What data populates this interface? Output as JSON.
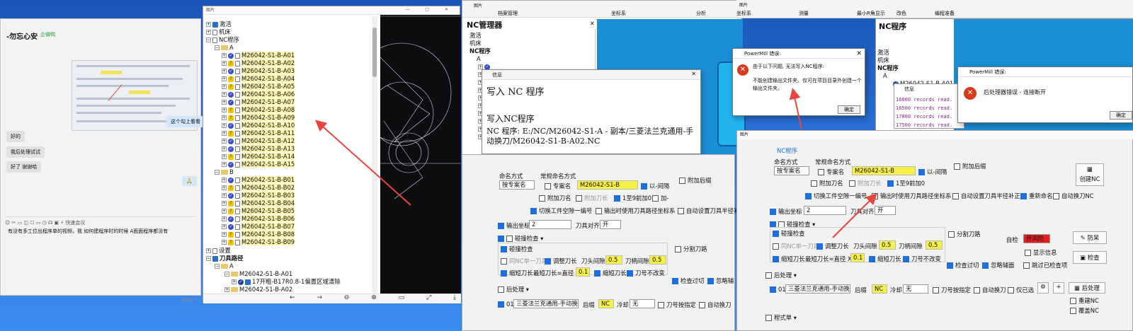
{
  "chat": {
    "contact": "-勿忘心安",
    "contact_tag": "企微鸭",
    "msg_check": "这个勾上看看",
    "msg_ok": "好的",
    "msg_try": "我后处理试试",
    "msg_thanks": "好了 谢谢哈",
    "msg_emoji": "🙏",
    "tools": "☺  ✂  ▭  ◫  ☐  ▭  ◷  ☊  ▣   ⚡ 快速会议",
    "input_text": "有没有多工位出程序单的视频，我 如何建程序时的时候 A面面程序都没有",
    "send_label": "发送(S)"
  },
  "tree": {
    "title": "图片",
    "nodes": {
      "activate": "激活",
      "machine": "机床",
      "ncprog": "NC程序",
      "groupA": "A",
      "groupB": "B",
      "settings": "设置",
      "toolpath": "刀具路径",
      "tpA": "A",
      "tp1": "M26042-S1-B-A01",
      "tp1sub": "17开粗-B17R0.8-1偏置区域清除",
      "tp2": "M26042-S1-B-A02"
    },
    "a_items": [
      "M26042-S1-B-A01",
      "M26042-S1-B-A02",
      "M26042-S1-B-A03",
      "M26042-S1-B-A04",
      "M26042-S1-B-A05",
      "M26042-S1-B-A06",
      "M26042-S1-B-A07",
      "M26042-S1-B-A08",
      "M26042-S1-B-A09",
      "M26042-S1-B-A10",
      "M26042-S1-B-A11",
      "M26042-S1-B-A12",
      "M26042-S1-B-A13",
      "M26042-S1-B-A14",
      "M26042-S1-B-A15"
    ],
    "b_items": [
      "M26042-S1-B-B01",
      "M26042-S1-B-B02",
      "M26042-S1-B-B03",
      "M26042-S1-B-B04",
      "M26042-S1-B-B05",
      "M26042-S1-B-B06",
      "M26042-S1-B-B07",
      "M26042-S1-B-B08",
      "M26042-S1-B-B09"
    ],
    "toolbar": "←  →  ⊖  ⊕  ▭  ⤢  ⤓  ⤡"
  },
  "mid": {
    "title_bar": "图片",
    "menu": [
      "档案管理",
      "坐标系",
      "分析",
      "测量",
      "最小R角显示",
      "改色",
      "编程准备"
    ],
    "manager_title": "NC管理器",
    "left_nodes": [
      "激活",
      "机床",
      "NC程序",
      "A"
    ],
    "info_title": "信息",
    "info_big": "写入 NC 程序",
    "info_line2": "写入NC程序",
    "info_line3": "NC 程序:  E:/NC/M26042-S1-A - 副本/三菱法兰克通用-手动换刀/M26042-S1-B-A02.NC",
    "err_title": "PowerMill 错误:",
    "err_msg1": "由于以下问题, 无法写入NC程序:",
    "err_msg2": "不能创建输出文件夹。仅可在项目目录外创建一个输出文件夹。",
    "err_btn": "确定"
  },
  "optL": {
    "nc_label": "NC程序",
    "naming": "命名方式",
    "naming_sel": "按专案名",
    "regular_naming": "常规命名方式",
    "proj_name": "专案名",
    "proj_value": "M26042-S1-B",
    "interval": "以-间隔",
    "append_post": "附加后缀",
    "append_tool": "附加刀名",
    "append_len": "附加刀长",
    "pad9": "1至9前加0",
    "add": "加-",
    "switch_ws": "切换工件空隙一编号",
    "output_coord": "输出时使用刀具路径坐标系",
    "auto_radius": "自动设置刀具半径补",
    "out_coord": "输出坐标",
    "out_coord_val": "2",
    "tool_align": "刀具对齐",
    "tool_align_val": "开",
    "collision": "碰撞检查",
    "collision_chk": "碰撞检查",
    "same_nc": "同NC单一刀具",
    "adjust_len": "调整刀长",
    "head_gap": "刀头间隙",
    "head_gap_val": "0.5",
    "shank_gap": "刀柄间隙",
    "shank_gap_val": "0.5",
    "shorten": "缩短刀长",
    "min_len": "最短刀长=直径 X",
    "min_len_val": "0.1",
    "shorten2": "缩短刀长",
    "tool_no_change": "刀号不改变",
    "split": "分割刀路",
    "check_over": "检查过切",
    "ignore": "忽略辅",
    "post": "后处理",
    "post01": "01",
    "post_sel": "三菱法兰克通用-手动换",
    "suffix": "后缀",
    "suffix_val": "NC",
    "coolant": "冷却",
    "coolant_val": "无",
    "tool_change_cfg": "刀号按指定",
    "auto_change": "自动换刀"
  },
  "right": {
    "title_bar": "图片",
    "menu": [
      "坐标系",
      "分析",
      "测量",
      "最小R角显示",
      "改色",
      "编程准备"
    ],
    "tree_title": "NC程序",
    "left_nodes": [
      "激活",
      "机床",
      "NC程序",
      "A",
      "M26042-S1-B-A01"
    ],
    "info_title": "信息",
    "records": [
      "16000 records read.",
      "16500 records read.",
      "17000 records read.",
      "17500 records read."
    ],
    "err_title": "PowerMill 错误:",
    "err_msg": "后处理器错误 - 连接断开",
    "err_btn": "确定"
  },
  "optR": {
    "nc_label": "NC程序",
    "naming": "命名方式",
    "naming_sel": "按专案名",
    "regular_naming": "常规命名方式",
    "proj_name": "专案名",
    "proj_value": "M26042-S1-B",
    "interval": "以-间隔",
    "append_post": "附加后缀",
    "append_tool": "附加刀名",
    "append_len": "附加刀长",
    "pad9": "1至9前加0",
    "create_nc": "创建NC",
    "switch_ws": "切换工件空隙一编号",
    "output_coord": "输出时使用刀具路径坐标系",
    "auto_radius": "自动设置刀具半径补正",
    "rename": "重新命名",
    "auto_tc": "自动换刀NC",
    "out_coord": "输出坐标",
    "out_coord_val": "2",
    "tool_align": "刀具对齐",
    "tool_align_val": "开",
    "collision": "碰撞检查",
    "collision_chk": "碰撞检查",
    "same_nc": "同NC单一刀具",
    "adjust_len": "调整刀长",
    "head_gap": "刀头间隙",
    "head_gap_val": "0.5",
    "shank_gap": "刀柄间隙",
    "shank_gap_val": "0.5",
    "shorten": "缩短刀长",
    "min_len": "最短刀长=直径 X",
    "min_len_val": "0.1",
    "shorten2": "缩短刀长",
    "tool_no_change": "刀号不改变",
    "split": "分割刀路",
    "self_check": "自检",
    "self_check_val": "开风险",
    "prevent": "防呆",
    "show_info": "显示信息",
    "check": "检查",
    "check_over": "检查过切",
    "ignore": "忽略辅面",
    "skip": "跳过已检查项",
    "post": "后处理",
    "post01": "01",
    "post_sel": "三菱法兰克通用-手动换",
    "suffix": "后缀",
    "suffix_val": "NC",
    "coolant": "冷却",
    "coolant_val": "无",
    "tool_change_cfg": "刀号按指定",
    "auto_change": "自动换刀",
    "only_sel": "仅已选",
    "postbtn": "后处理",
    "rebuild": "重建NC",
    "overwrite": "覆盖NC",
    "program_sheet": "程式单"
  }
}
